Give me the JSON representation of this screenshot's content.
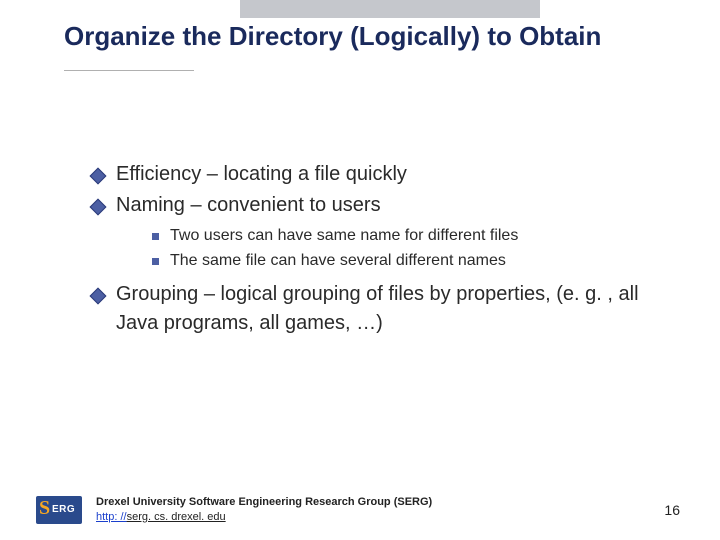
{
  "title": "Organize the Directory (Logically) to Obtain",
  "bullets": [
    {
      "text": "Efficiency – locating a file quickly"
    },
    {
      "text": "Naming – convenient to users",
      "sub": [
        "Two users can have same name for different files",
        "The same file can have several different names"
      ]
    },
    {
      "text": "Grouping – logical grouping of files by properties, (e. g. , all Java programs, all games, …)"
    }
  ],
  "footer": {
    "org": "Drexel University Software Engineering Research Group (SERG)",
    "link_prefix": "http: //",
    "link_tail": "serg. cs. drexel. edu"
  },
  "page_number": "16"
}
